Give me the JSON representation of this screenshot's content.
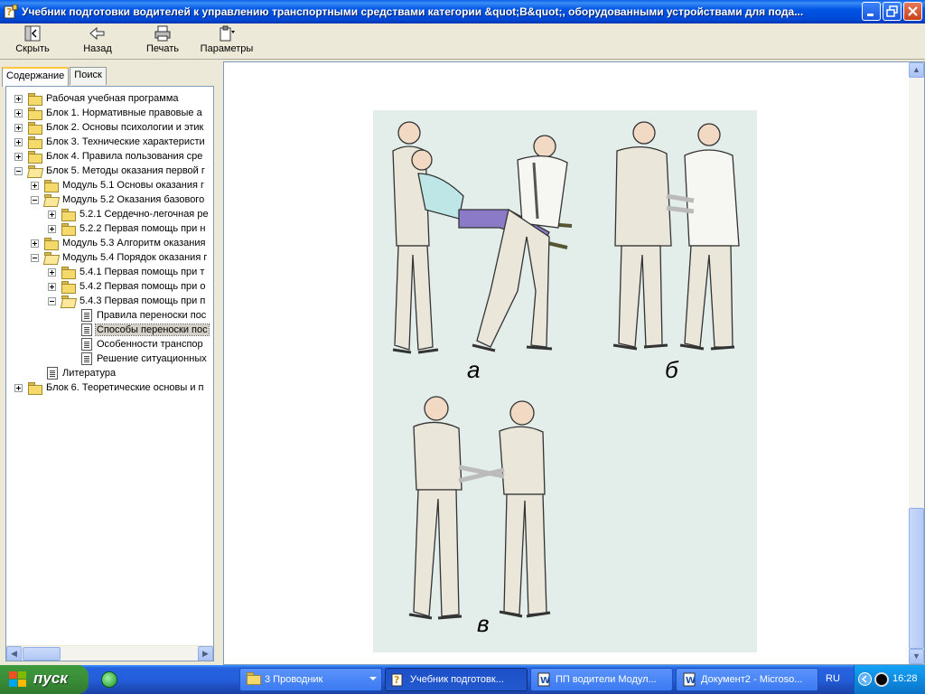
{
  "window": {
    "title": "Учебник подготовки водителей к управлению транспортными средствами категории &quot;B&quot;, оборудованными устройствами для пода..."
  },
  "toolbar": {
    "hide_label": "Скрыть",
    "back_label": "Назад",
    "print_label": "Печать",
    "options_label": "Параметры"
  },
  "tabs": {
    "contents_label": "Содержание",
    "search_label": "Поиск"
  },
  "tree": [
    {
      "label": "Рабочая учебная программа"
    },
    {
      "label": "Блок 1. Нормативные правовые а"
    },
    {
      "label": "Блок 2. Основы психологии и этик"
    },
    {
      "label": "Блок 3. Технические характеристи"
    },
    {
      "label": "Блок 4. Правила пользования сре"
    },
    {
      "label": "Блок 5. Методы оказания первой г"
    },
    {
      "label": "Модуль 5.1 Основы оказания г"
    },
    {
      "label": "Модуль 5.2 Оказания базового"
    },
    {
      "label": "5.2.1 Сердечно-легочная ре"
    },
    {
      "label": "5.2.2 Первая помощь при н"
    },
    {
      "label": "Модуль 5.3 Алгоритм оказания"
    },
    {
      "label": "Модуль 5.4 Порядок оказания г"
    },
    {
      "label": "5.4.1 Первая помощь при т"
    },
    {
      "label": "5.4.2 Первая помощь при о"
    },
    {
      "label": "5.4.3 Первая помощь при п"
    },
    {
      "label": "Правила переноски пос"
    },
    {
      "label": "Способы переноски пос"
    },
    {
      "label": "Особенности транспор"
    },
    {
      "label": "Решение ситуационных"
    },
    {
      "label": "Литература"
    },
    {
      "label": "Блок 6. Теоретические основы и п"
    }
  ],
  "figure": {
    "label_a": "а",
    "label_b": "б",
    "label_c": "в"
  },
  "taskbar": {
    "start_label": "пуск",
    "tasks": [
      {
        "label": "3 Проводник"
      },
      {
        "label": "Учебник подготовк..."
      },
      {
        "label": "ПП водители Модул..."
      },
      {
        "label": "Документ2 - Microso..."
      }
    ],
    "language": "RU",
    "clock": "16:28"
  }
}
